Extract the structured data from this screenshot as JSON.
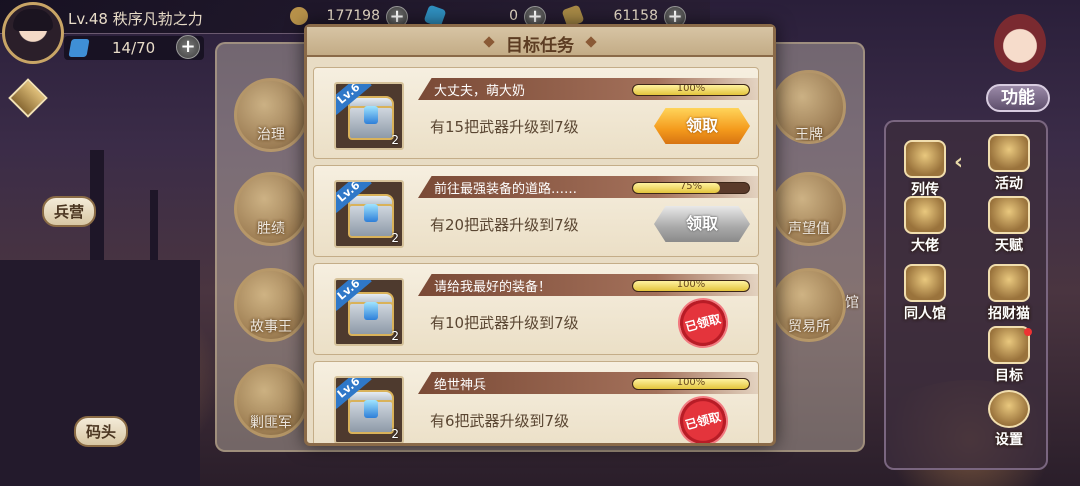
{
  "hud": {
    "level": "Lv.48",
    "player_name": "秩序凡勃之力",
    "gold": "177198",
    "gems": "0",
    "coins": "61158",
    "stamina": "14/70",
    "plus_label": "+"
  },
  "background": {
    "left_labels": [
      "兵营",
      "码头"
    ],
    "center_icons": [
      "治理",
      "胜绩",
      "故事王",
      "剿匪军",
      "王牌",
      "声望值",
      "贸易所"
    ],
    "partial_label": "馆"
  },
  "side_panel": {
    "func_label": "功能",
    "chevron": "‹",
    "items": [
      "列传",
      "活动",
      "大佬",
      "天赋",
      "同人馆",
      "招财猫",
      "目标",
      "设置"
    ]
  },
  "modal": {
    "title": "目标任务",
    "tasks": [
      {
        "name": "大丈夫，萌大奶",
        "progress_text": "100%",
        "progress": 100,
        "desc": "有15把武器升级到7级",
        "chest_level": "Lv.6",
        "chest_count": "2",
        "status": "active",
        "button_label": "领取"
      },
      {
        "name": "前往最强装备的道路……",
        "progress_text": "75%",
        "progress": 75,
        "desc": "有20把武器升级到7级",
        "chest_level": "Lv.6",
        "chest_count": "2",
        "status": "disabled",
        "button_label": "领取"
      },
      {
        "name": "请给我最好的装备！",
        "progress_text": "100%",
        "progress": 100,
        "desc": "有10把武器升级到7级",
        "chest_level": "Lv.6",
        "chest_count": "2",
        "status": "claimed",
        "button_label": "已领取"
      },
      {
        "name": "绝世神兵",
        "progress_text": "100%",
        "progress": 100,
        "desc": "有6把武器升级到7级",
        "chest_level": "Lv.6",
        "chest_count": "2",
        "status": "claimed",
        "button_label": "已领取"
      }
    ]
  },
  "colors": {
    "accent_orange": "#f49a1c",
    "claimed_red": "#e4343c",
    "panel_beige": "#e8dcc4"
  }
}
